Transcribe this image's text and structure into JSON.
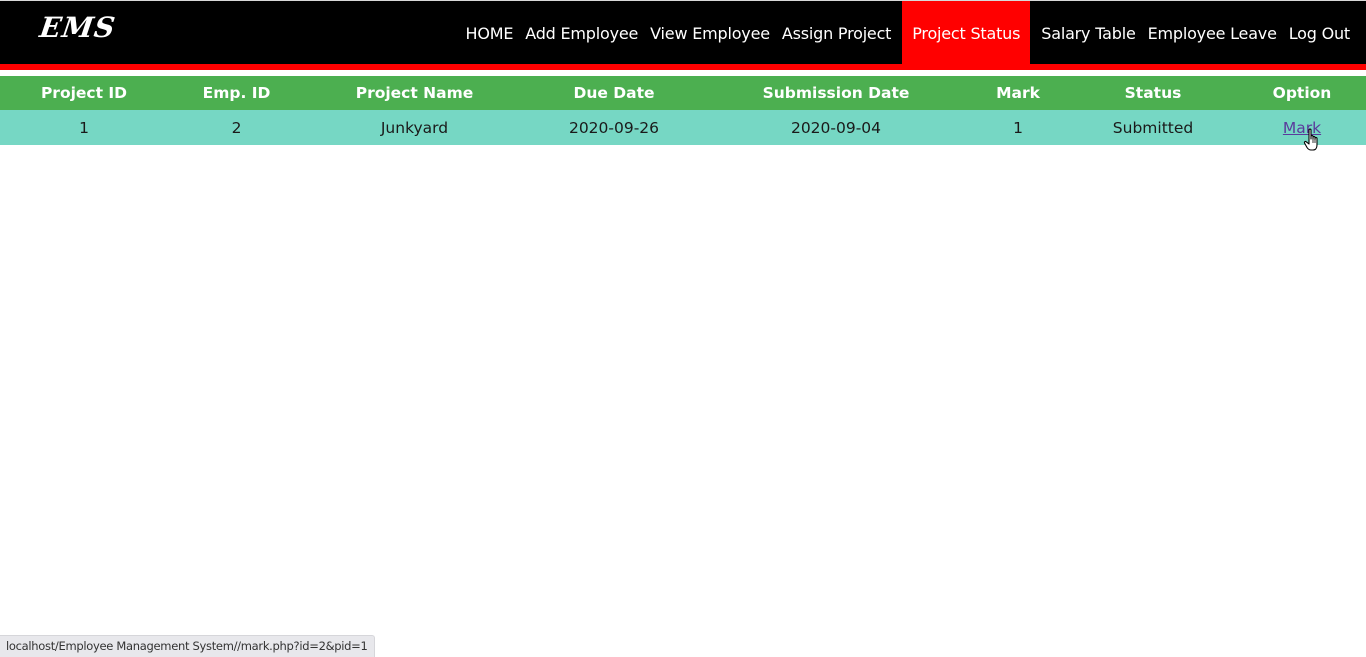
{
  "app": {
    "logo": "EMS"
  },
  "nav": {
    "items": [
      {
        "label": "HOME",
        "active": false
      },
      {
        "label": "Add Employee",
        "active": false
      },
      {
        "label": "View Employee",
        "active": false
      },
      {
        "label": "Assign Project",
        "active": false
      },
      {
        "label": "Project Status",
        "active": true
      },
      {
        "label": "Salary Table",
        "active": false
      },
      {
        "label": "Employee Leave",
        "active": false
      },
      {
        "label": "Log Out",
        "active": false
      }
    ]
  },
  "colors": {
    "navbar_bg": "#000000",
    "accent_red": "#ff0000",
    "table_header_bg": "#4caf50",
    "table_row_bg": "#76d7c4"
  },
  "table": {
    "columns": [
      "Project ID",
      "Emp. ID",
      "Project Name",
      "Due Date",
      "Submission Date",
      "Mark",
      "Status",
      "Option"
    ],
    "rows": [
      {
        "project_id": "1",
        "emp_id": "2",
        "project_name": "Junkyard",
        "due_date": "2020-09-26",
        "submission_date": "2020-09-04",
        "mark": "1",
        "status": "Submitted",
        "option_label": "Mark"
      }
    ]
  },
  "statusbar": {
    "url": "localhost/Employee Management System//mark.php?id=2&pid=1"
  }
}
